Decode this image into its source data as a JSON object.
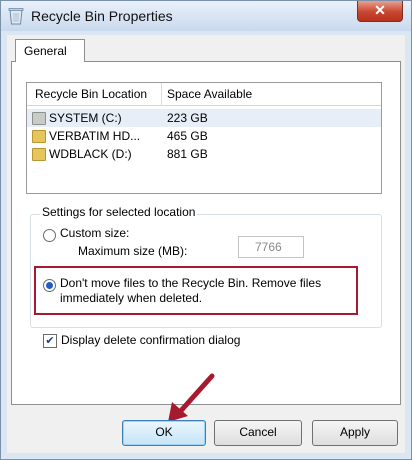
{
  "window": {
    "title": "Recycle Bin Properties",
    "close_glyph": "✕"
  },
  "tabs": [
    {
      "label": "General"
    }
  ],
  "locations": {
    "headers": {
      "location": "Recycle Bin Location",
      "space": "Space Available"
    },
    "rows": [
      {
        "name": "SYSTEM (C:)",
        "space": "223 GB",
        "icon": "drive-icon",
        "selected": true
      },
      {
        "name": "VERBATIM HD...",
        "space": "465 GB",
        "icon": "folder-icon",
        "selected": false
      },
      {
        "name": "WDBLACK (D:)",
        "space": "881 GB",
        "icon": "folder-icon",
        "selected": false
      }
    ]
  },
  "settings": {
    "group_label": "Settings for selected location",
    "custom_size_label": "Custom size:",
    "max_size_label": "Maximum size (MB):",
    "max_size_value": "7766",
    "dont_move_label_line1": "Don't move files to the Recycle Bin. Remove files",
    "dont_move_label_line2": "immediately when deleted.",
    "selected_option": "dont_move"
  },
  "confirm": {
    "label": "Display delete confirmation dialog",
    "checked": true,
    "check_glyph": "✔"
  },
  "buttons": {
    "ok": "OK",
    "cancel": "Cancel",
    "apply": "Apply"
  },
  "colors": {
    "annotation": "#a6192e",
    "accent": "#1d5fbf"
  }
}
